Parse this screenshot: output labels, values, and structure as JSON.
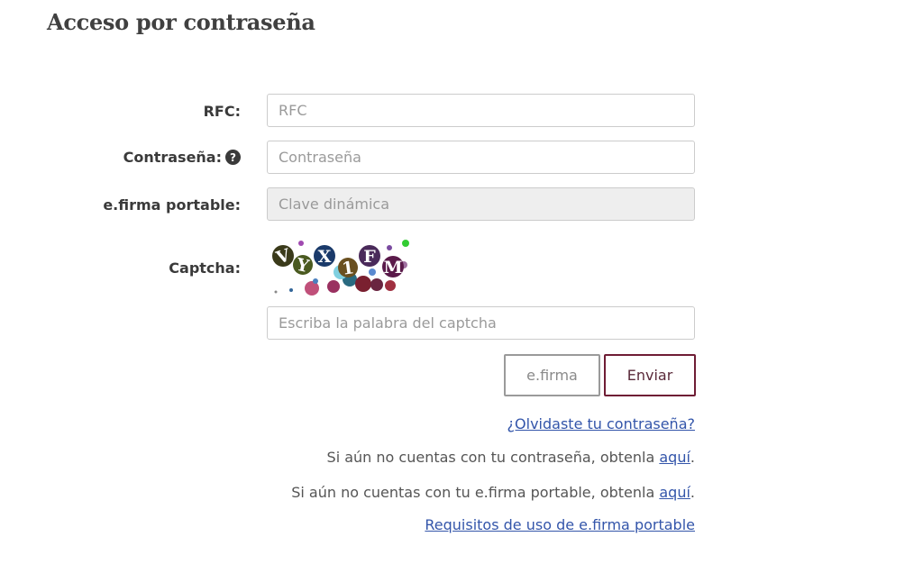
{
  "page": {
    "title": "Acceso por contraseña"
  },
  "form": {
    "rfc": {
      "label": "RFC:",
      "placeholder": "RFC",
      "value": ""
    },
    "password": {
      "label": "Contraseña:",
      "help_icon": "question-circle-icon",
      "placeholder": "Contraseña",
      "value": ""
    },
    "efirma_portable": {
      "label": "e.firma portable:",
      "placeholder": "Clave dinámica",
      "value": "",
      "disabled": true
    },
    "captcha": {
      "label": "Captcha:",
      "image_text": "VYX1FM",
      "placeholder": "Escriba la palabra del captcha",
      "value": ""
    }
  },
  "buttons": {
    "efirma_label": "e.firma",
    "submit_label": "Enviar"
  },
  "links": {
    "forgot_password": "¿Olvidaste tu contraseña?",
    "no_password_text": "Si aún no cuentas con tu contraseña, obtenla ",
    "no_password_link": "aquí",
    "no_efirma_text": "Si aún no cuentas con tu e.firma portable, obtenla ",
    "no_efirma_link": "aquí",
    "requirements": "Requisitos de uso de e.firma portable"
  },
  "colors": {
    "submit_border": "#6f1d35",
    "link": "#3355aa",
    "disabled_bg": "#eeeeee"
  }
}
